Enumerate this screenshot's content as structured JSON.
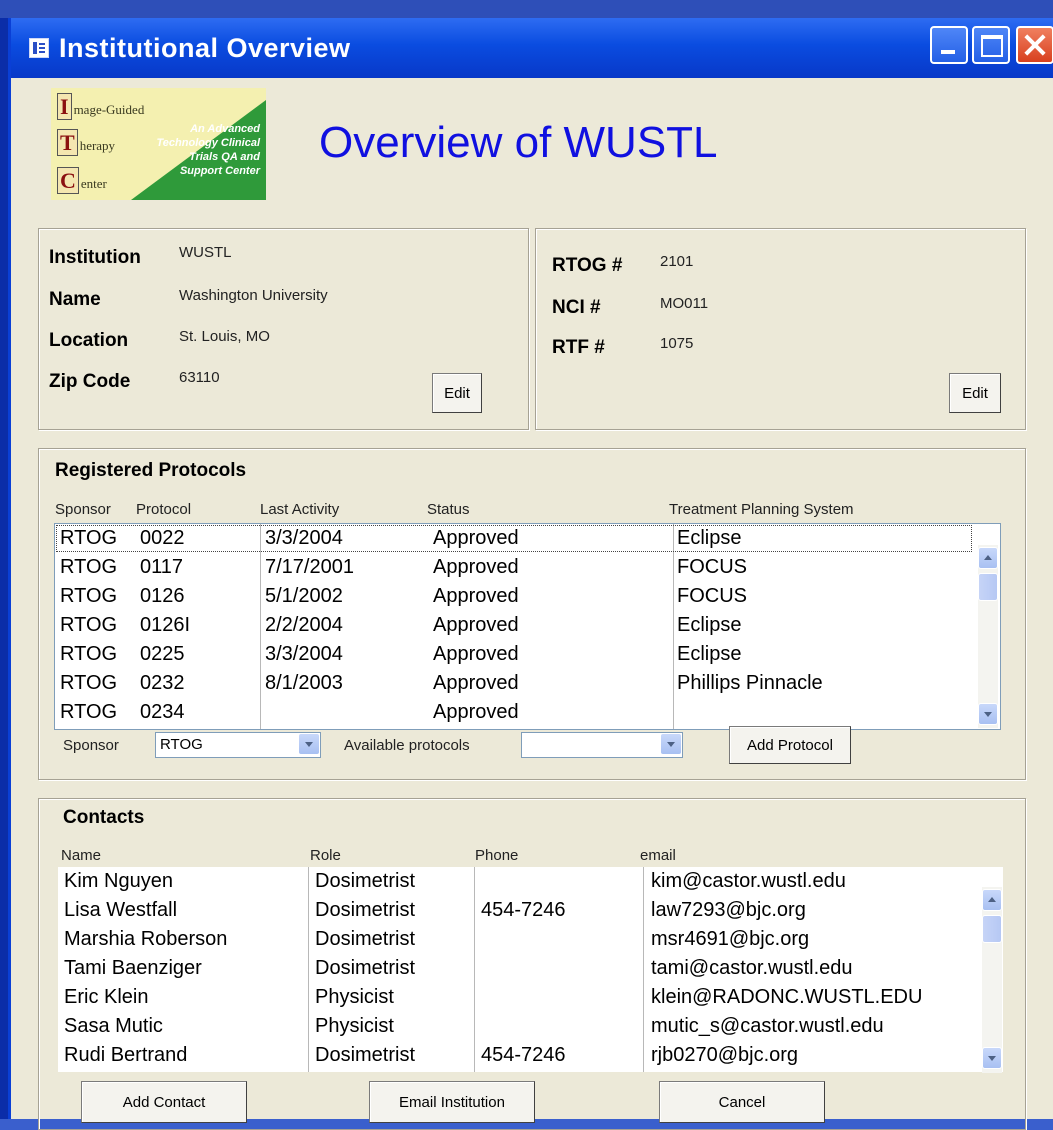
{
  "window": {
    "title": "Institutional Overview"
  },
  "logo": {
    "line1_initial": "I",
    "line1_rest": "mage-Guided",
    "line2_initial": "T",
    "line2_rest": "herapy",
    "line3_initial": "C",
    "line3_rest": "enter",
    "tagline": "An Advanced Technology Clinical Trials QA and Support Center"
  },
  "page_title": "Overview of WUSTL",
  "institution": {
    "institution_label": "Institution",
    "institution_value": "WUSTL",
    "name_label": "Name",
    "name_value": "Washington University",
    "location_label": "Location",
    "location_value": "St. Louis, MO",
    "zip_label": "Zip Code",
    "zip_value": "63110",
    "edit_label": "Edit"
  },
  "ids": {
    "rtog_label": "RTOG #",
    "rtog_value": "2101",
    "nci_label": "NCI #",
    "nci_value": "MO011",
    "rtf_label": "RTF #",
    "rtf_value": "1075",
    "edit_label": "Edit"
  },
  "protocols": {
    "title": "Registered Protocols",
    "columns": [
      "Sponsor",
      "Protocol",
      "Last Activity",
      "Status",
      "Treatment Planning System"
    ],
    "rows": [
      [
        "RTOG",
        "0022",
        "3/3/2004",
        "Approved",
        "Eclipse"
      ],
      [
        "RTOG",
        "0117",
        "7/17/2001",
        "Approved",
        "FOCUS"
      ],
      [
        "RTOG",
        "0126",
        "5/1/2002",
        "Approved",
        "FOCUS"
      ],
      [
        "RTOG",
        "0126I",
        "2/2/2004",
        "Approved",
        "Eclipse"
      ],
      [
        "RTOG",
        "0225",
        "3/3/2004",
        "Approved",
        "Eclipse"
      ],
      [
        "RTOG",
        "0232",
        "8/1/2003",
        "Approved",
        "Phillips Pinnacle"
      ],
      [
        "RTOG",
        "0234",
        "",
        "Approved",
        ""
      ]
    ],
    "sponsor_label": "Sponsor",
    "sponsor_value": "RTOG",
    "available_label": "Available protocols",
    "available_value": "",
    "add_button": "Add Protocol"
  },
  "contacts": {
    "title": "Contacts",
    "columns": [
      "Name",
      "Role",
      "Phone",
      "email"
    ],
    "rows": [
      [
        "Kim Nguyen",
        "Dosimetrist",
        "",
        "kim@castor.wustl.edu"
      ],
      [
        "Lisa Westfall",
        "Dosimetrist",
        "454-7246",
        "law7293@bjc.org"
      ],
      [
        "Marshia Roberson",
        "Dosimetrist",
        "",
        "msr4691@bjc.org"
      ],
      [
        "Tami Baenziger",
        "Dosimetrist",
        "",
        "tami@castor.wustl.edu"
      ],
      [
        "Eric Klein",
        "Physicist",
        "",
        "klein@RADONC.WUSTL.EDU"
      ],
      [
        "Sasa Mutic",
        "Physicist",
        "",
        "mutic_s@castor.wustl.edu"
      ],
      [
        "Rudi Bertrand",
        "Dosimetrist",
        "454-7246",
        "rjb0270@bjc.org"
      ]
    ],
    "add_button": "Add Contact",
    "email_button": "Email Institution",
    "cancel_button": "Cancel"
  },
  "colors": {
    "title_blue": "#1010e0",
    "titlebar": "#0a4ce0",
    "window_bg": "#ece9d8"
  }
}
